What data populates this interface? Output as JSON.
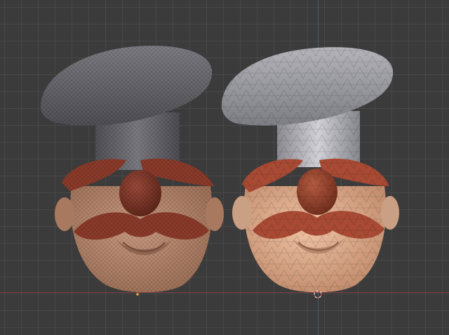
{
  "viewport": {
    "mode": "orthographic-front",
    "grid": true,
    "axis_colors": {
      "x": "#8a3c47",
      "z": "#4c6b86"
    }
  },
  "models": [
    {
      "id": "left",
      "display": "wireframe-dense",
      "hat_color": "#6e6e73",
      "skin_color": "#b98a6f",
      "mustache_color": "#8a3a2a"
    },
    {
      "id": "right",
      "display": "faceted-low-poly",
      "hat_color": "#9a9aa0",
      "skin_color": "#d9a888",
      "mustache_color": "#a84a34"
    }
  ],
  "icons": [
    "origin-marker-icon",
    "3d-cursor-icon"
  ],
  "colors": {
    "background": "#3b3b3b",
    "grid": "#505050"
  }
}
